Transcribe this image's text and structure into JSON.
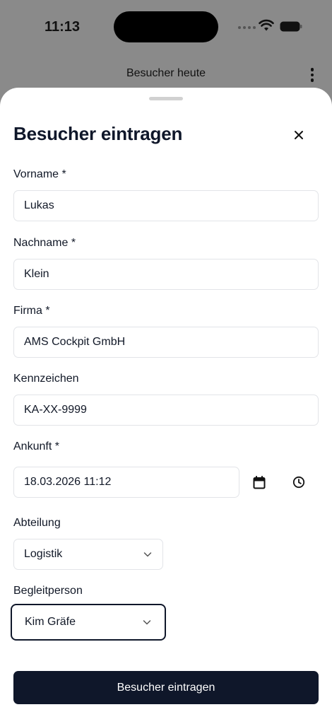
{
  "status_bar": {
    "time": "11:13"
  },
  "background_header": {
    "title": "Besucher heute"
  },
  "sheet": {
    "title": "Besucher eintragen",
    "fields": {
      "first_name": {
        "label": "Vorname *",
        "value": "Lukas"
      },
      "last_name": {
        "label": "Nachname *",
        "value": "Klein"
      },
      "company": {
        "label": "Firma *",
        "value": "AMS Cockpit GmbH"
      },
      "plate": {
        "label": "Kennzeichen",
        "value": "KA-XX-9999"
      },
      "arrival": {
        "label": "Ankunft *",
        "value": "18.03.2026 11:12"
      },
      "department": {
        "label": "Abteilung",
        "value": "Logistik"
      },
      "escort": {
        "label": "Begleitperson",
        "value": "Kim Gräfe"
      }
    },
    "submit_label": "Besucher eintragen"
  },
  "colors": {
    "primary": "#0f172a",
    "border": "#e2e4e8",
    "overlay": "#8a8a8a"
  },
  "icons": [
    "close-icon",
    "calendar-icon",
    "clock-icon",
    "chevron-down-icon",
    "more-vertical-icon",
    "wifi-icon",
    "battery-icon"
  ]
}
